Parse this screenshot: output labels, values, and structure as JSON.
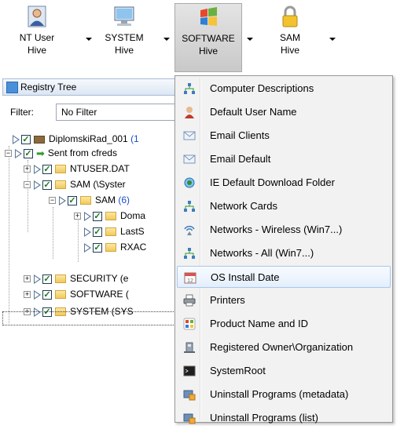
{
  "toolbar": {
    "buttons": [
      {
        "line1": "NT User",
        "line2": "Hive",
        "icon": "user-icon"
      },
      {
        "line1": "SYSTEM",
        "line2": "Hive",
        "icon": "monitor-icon"
      },
      {
        "line1": "SOFTWARE",
        "line2": "Hive",
        "icon": "windows-logo-icon"
      },
      {
        "line1": "SAM",
        "line2": "Hive",
        "icon": "padlock-icon"
      }
    ]
  },
  "panel": {
    "title": "Registry Tree",
    "filter_label": "Filter:",
    "filter_value": "No Filter"
  },
  "tree": {
    "root_label": "DiplomskiRad_001",
    "root_count": "(1",
    "sent_label": "Sent from cfreds",
    "ntuser_label": "NTUSER.DAT",
    "sam_label": "SAM (\\Syster",
    "sam_child_label": "SAM",
    "sam_child_count": "(6)",
    "doma_label": "Doma",
    "lasts_label": "LastS",
    "rxac_label": "RXAC",
    "security_label": "SECURITY (e",
    "software_label": "SOFTWARE (",
    "system_label": "SYSTEM (SYS"
  },
  "menu": {
    "items": [
      {
        "label": "Computer Descriptions",
        "icon": "network-icon"
      },
      {
        "label": "Default User Name",
        "icon": "user-icon"
      },
      {
        "label": "Email Clients",
        "icon": "envelope-icon"
      },
      {
        "label": "Email Default",
        "icon": "envelope-icon"
      },
      {
        "label": "IE Default Download Folder",
        "icon": "globe-icon"
      },
      {
        "label": "Network Cards",
        "icon": "network-icon"
      },
      {
        "label": "Networks - Wireless (Win7...)",
        "icon": "wireless-icon"
      },
      {
        "label": "Networks - All (Win7...)",
        "icon": "network-icon"
      },
      {
        "label": "OS Install Date",
        "icon": "calendar-icon"
      },
      {
        "label": "Printers",
        "icon": "printer-icon"
      },
      {
        "label": "Product Name and ID",
        "icon": "windows-logo-icon"
      },
      {
        "label": "Registered Owner\\Organization",
        "icon": "building-icon"
      },
      {
        "label": "SystemRoot",
        "icon": "console-icon"
      },
      {
        "label": "Uninstall Programs (metadata)",
        "icon": "installer-icon"
      },
      {
        "label": "Uninstall Programs (list)",
        "icon": "installer-icon"
      }
    ],
    "hovered_index": 8
  }
}
